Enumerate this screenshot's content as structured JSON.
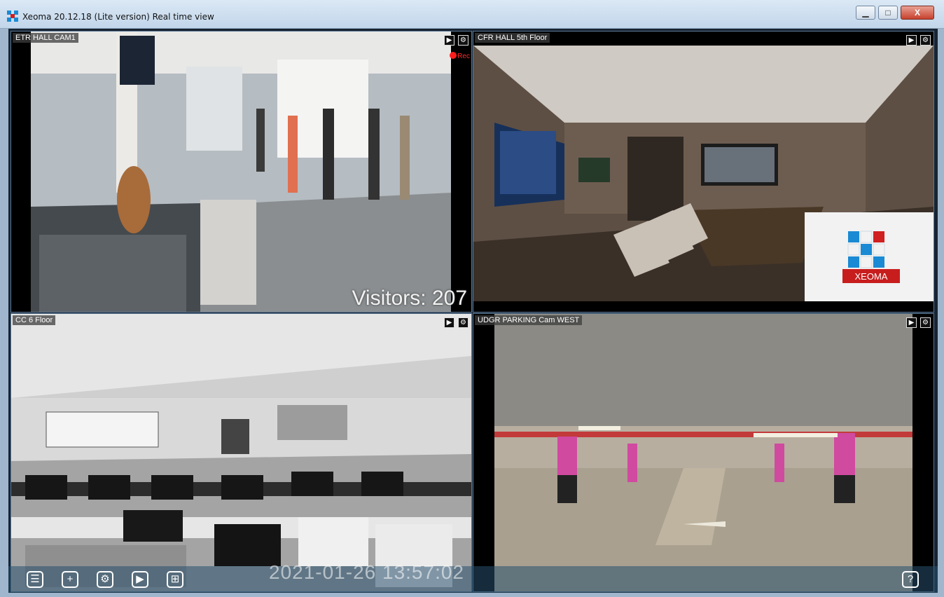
{
  "window": {
    "title": "Xeoma 20.12.18 (Lite version) Real time view",
    "controls": {
      "minimize": "▁",
      "maximize": "□",
      "close": "X"
    }
  },
  "cameras": [
    {
      "label": "ETR HALL CAM1",
      "rec_label": "Rec",
      "overlay_text": "Visitors: 207"
    },
    {
      "label": "CFR HALL 5th Floor",
      "logo_text": "XEOMA"
    },
    {
      "label": "CC 6 Floor"
    },
    {
      "label": "UDGR PARKING Cam WEST"
    }
  ],
  "tile_buttons": {
    "play": "▶",
    "settings": "⚙"
  },
  "timestamp": "2021-01-26 13:57:02",
  "toolbar": {
    "list": "☰",
    "add": "+",
    "settings": "⚙",
    "play": "▶",
    "layout": "⊞",
    "help": "?"
  },
  "colors": {
    "accent_border": "#5b7896",
    "rec_red": "#ff1c1c",
    "logo_red": "#d02020",
    "logo_blue": "#1a8ad4",
    "parking_pillar": "#d04aa0"
  },
  "icons": [
    "xeoma-logo-icon",
    "minimize-icon",
    "maximize-icon",
    "close-icon",
    "play-icon",
    "gear-icon",
    "list-icon",
    "plus-icon",
    "grid-icon",
    "help-icon",
    "rec-dot-icon"
  ]
}
